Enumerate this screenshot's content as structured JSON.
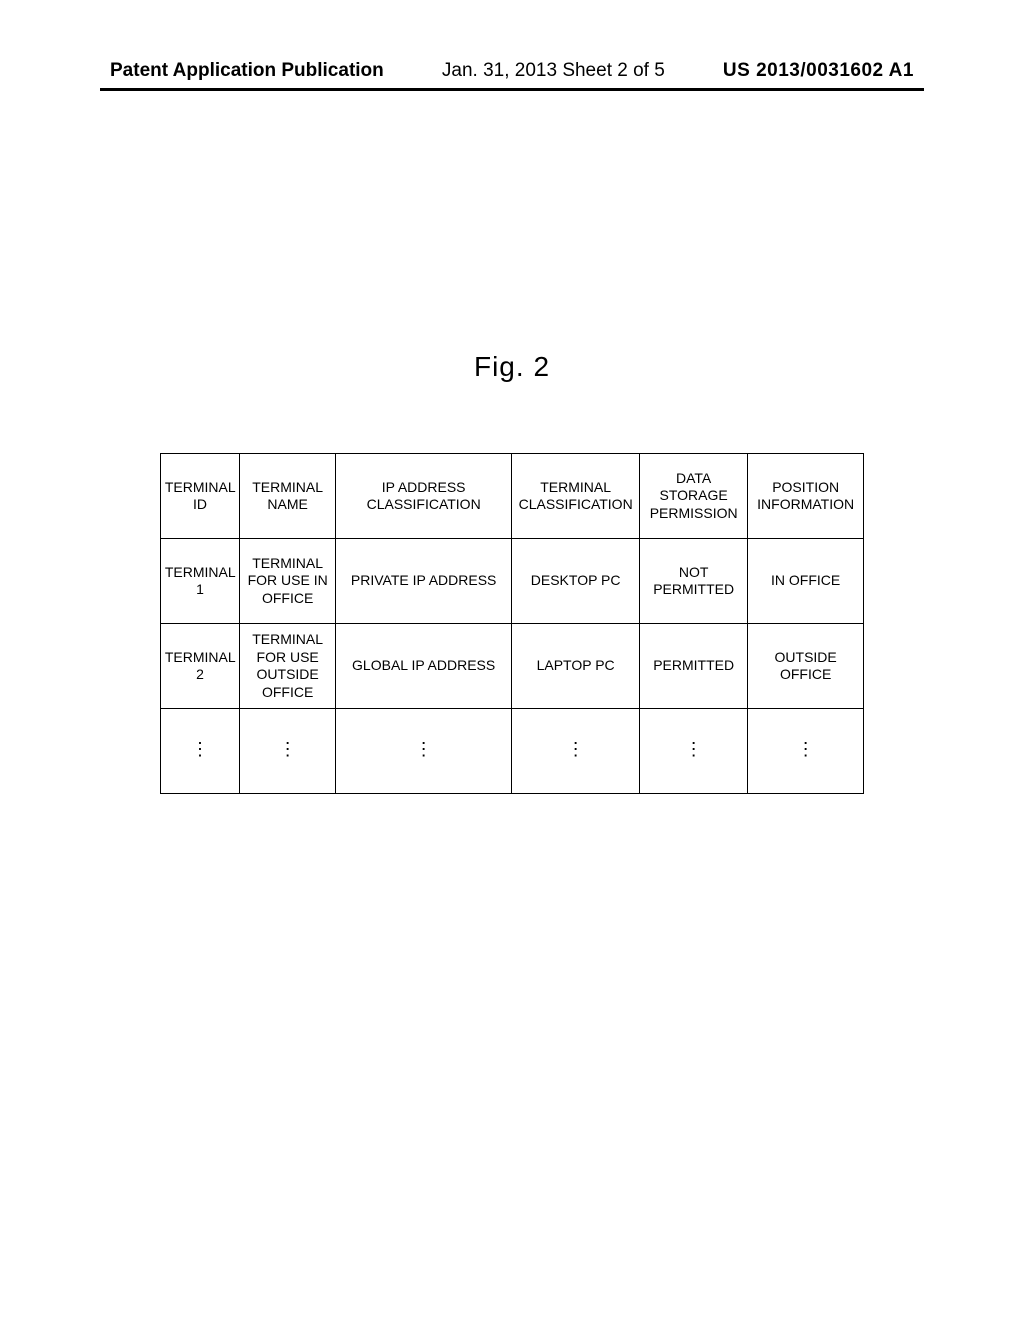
{
  "header": {
    "left": "Patent Application Publication",
    "center": "Jan. 31, 2013  Sheet 2 of 5",
    "right": "US 2013/0031602 A1"
  },
  "figure_label": "Fig. 2",
  "chart_data": {
    "type": "table",
    "columns": [
      "TERMINAL ID",
      "TERMINAL NAME",
      "IP ADDRESS CLASSIFICATION",
      "TERMINAL CLASSIFICATION",
      "DATA STORAGE PERMISSION",
      "POSITION INFORMATION"
    ],
    "rows": [
      {
        "terminal_id": "TERMINAL 1",
        "terminal_name": "TERMINAL FOR USE IN OFFICE",
        "ip_class": "PRIVATE IP ADDRESS",
        "terminal_class": "DESKTOP PC",
        "data_storage": "NOT PERMITTED",
        "position": "IN OFFICE"
      },
      {
        "terminal_id": "TERMINAL 2",
        "terminal_name": "TERMINAL FOR USE OUTSIDE OFFICE",
        "ip_class": "GLOBAL IP ADDRESS",
        "terminal_class": "LAPTOP PC",
        "data_storage": "PERMITTED",
        "position": "OUTSIDE OFFICE"
      }
    ],
    "ellipsis_glyph": "⋮"
  }
}
